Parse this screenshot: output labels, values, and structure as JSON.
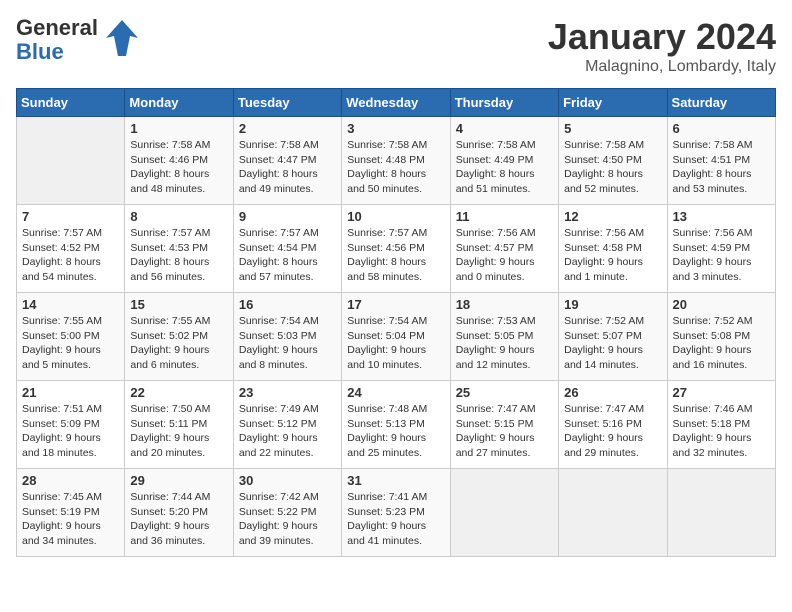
{
  "logo": {
    "line1": "General",
    "line2": "Blue"
  },
  "title": "January 2024",
  "location": "Malagnino, Lombardy, Italy",
  "headers": [
    "Sunday",
    "Monday",
    "Tuesday",
    "Wednesday",
    "Thursday",
    "Friday",
    "Saturday"
  ],
  "weeks": [
    [
      {
        "day": "",
        "sunrise": "",
        "sunset": "",
        "daylight": ""
      },
      {
        "day": "1",
        "sunrise": "Sunrise: 7:58 AM",
        "sunset": "Sunset: 4:46 PM",
        "daylight": "Daylight: 8 hours and 48 minutes."
      },
      {
        "day": "2",
        "sunrise": "Sunrise: 7:58 AM",
        "sunset": "Sunset: 4:47 PM",
        "daylight": "Daylight: 8 hours and 49 minutes."
      },
      {
        "day": "3",
        "sunrise": "Sunrise: 7:58 AM",
        "sunset": "Sunset: 4:48 PM",
        "daylight": "Daylight: 8 hours and 50 minutes."
      },
      {
        "day": "4",
        "sunrise": "Sunrise: 7:58 AM",
        "sunset": "Sunset: 4:49 PM",
        "daylight": "Daylight: 8 hours and 51 minutes."
      },
      {
        "day": "5",
        "sunrise": "Sunrise: 7:58 AM",
        "sunset": "Sunset: 4:50 PM",
        "daylight": "Daylight: 8 hours and 52 minutes."
      },
      {
        "day": "6",
        "sunrise": "Sunrise: 7:58 AM",
        "sunset": "Sunset: 4:51 PM",
        "daylight": "Daylight: 8 hours and 53 minutes."
      }
    ],
    [
      {
        "day": "7",
        "sunrise": "Sunrise: 7:57 AM",
        "sunset": "Sunset: 4:52 PM",
        "daylight": "Daylight: 8 hours and 54 minutes."
      },
      {
        "day": "8",
        "sunrise": "Sunrise: 7:57 AM",
        "sunset": "Sunset: 4:53 PM",
        "daylight": "Daylight: 8 hours and 56 minutes."
      },
      {
        "day": "9",
        "sunrise": "Sunrise: 7:57 AM",
        "sunset": "Sunset: 4:54 PM",
        "daylight": "Daylight: 8 hours and 57 minutes."
      },
      {
        "day": "10",
        "sunrise": "Sunrise: 7:57 AM",
        "sunset": "Sunset: 4:56 PM",
        "daylight": "Daylight: 8 hours and 58 minutes."
      },
      {
        "day": "11",
        "sunrise": "Sunrise: 7:56 AM",
        "sunset": "Sunset: 4:57 PM",
        "daylight": "Daylight: 9 hours and 0 minutes."
      },
      {
        "day": "12",
        "sunrise": "Sunrise: 7:56 AM",
        "sunset": "Sunset: 4:58 PM",
        "daylight": "Daylight: 9 hours and 1 minute."
      },
      {
        "day": "13",
        "sunrise": "Sunrise: 7:56 AM",
        "sunset": "Sunset: 4:59 PM",
        "daylight": "Daylight: 9 hours and 3 minutes."
      }
    ],
    [
      {
        "day": "14",
        "sunrise": "Sunrise: 7:55 AM",
        "sunset": "Sunset: 5:00 PM",
        "daylight": "Daylight: 9 hours and 5 minutes."
      },
      {
        "day": "15",
        "sunrise": "Sunrise: 7:55 AM",
        "sunset": "Sunset: 5:02 PM",
        "daylight": "Daylight: 9 hours and 6 minutes."
      },
      {
        "day": "16",
        "sunrise": "Sunrise: 7:54 AM",
        "sunset": "Sunset: 5:03 PM",
        "daylight": "Daylight: 9 hours and 8 minutes."
      },
      {
        "day": "17",
        "sunrise": "Sunrise: 7:54 AM",
        "sunset": "Sunset: 5:04 PM",
        "daylight": "Daylight: 9 hours and 10 minutes."
      },
      {
        "day": "18",
        "sunrise": "Sunrise: 7:53 AM",
        "sunset": "Sunset: 5:05 PM",
        "daylight": "Daylight: 9 hours and 12 minutes."
      },
      {
        "day": "19",
        "sunrise": "Sunrise: 7:52 AM",
        "sunset": "Sunset: 5:07 PM",
        "daylight": "Daylight: 9 hours and 14 minutes."
      },
      {
        "day": "20",
        "sunrise": "Sunrise: 7:52 AM",
        "sunset": "Sunset: 5:08 PM",
        "daylight": "Daylight: 9 hours and 16 minutes."
      }
    ],
    [
      {
        "day": "21",
        "sunrise": "Sunrise: 7:51 AM",
        "sunset": "Sunset: 5:09 PM",
        "daylight": "Daylight: 9 hours and 18 minutes."
      },
      {
        "day": "22",
        "sunrise": "Sunrise: 7:50 AM",
        "sunset": "Sunset: 5:11 PM",
        "daylight": "Daylight: 9 hours and 20 minutes."
      },
      {
        "day": "23",
        "sunrise": "Sunrise: 7:49 AM",
        "sunset": "Sunset: 5:12 PM",
        "daylight": "Daylight: 9 hours and 22 minutes."
      },
      {
        "day": "24",
        "sunrise": "Sunrise: 7:48 AM",
        "sunset": "Sunset: 5:13 PM",
        "daylight": "Daylight: 9 hours and 25 minutes."
      },
      {
        "day": "25",
        "sunrise": "Sunrise: 7:47 AM",
        "sunset": "Sunset: 5:15 PM",
        "daylight": "Daylight: 9 hours and 27 minutes."
      },
      {
        "day": "26",
        "sunrise": "Sunrise: 7:47 AM",
        "sunset": "Sunset: 5:16 PM",
        "daylight": "Daylight: 9 hours and 29 minutes."
      },
      {
        "day": "27",
        "sunrise": "Sunrise: 7:46 AM",
        "sunset": "Sunset: 5:18 PM",
        "daylight": "Daylight: 9 hours and 32 minutes."
      }
    ],
    [
      {
        "day": "28",
        "sunrise": "Sunrise: 7:45 AM",
        "sunset": "Sunset: 5:19 PM",
        "daylight": "Daylight: 9 hours and 34 minutes."
      },
      {
        "day": "29",
        "sunrise": "Sunrise: 7:44 AM",
        "sunset": "Sunset: 5:20 PM",
        "daylight": "Daylight: 9 hours and 36 minutes."
      },
      {
        "day": "30",
        "sunrise": "Sunrise: 7:42 AM",
        "sunset": "Sunset: 5:22 PM",
        "daylight": "Daylight: 9 hours and 39 minutes."
      },
      {
        "day": "31",
        "sunrise": "Sunrise: 7:41 AM",
        "sunset": "Sunset: 5:23 PM",
        "daylight": "Daylight: 9 hours and 41 minutes."
      },
      {
        "day": "",
        "sunrise": "",
        "sunset": "",
        "daylight": ""
      },
      {
        "day": "",
        "sunrise": "",
        "sunset": "",
        "daylight": ""
      },
      {
        "day": "",
        "sunrise": "",
        "sunset": "",
        "daylight": ""
      }
    ]
  ]
}
